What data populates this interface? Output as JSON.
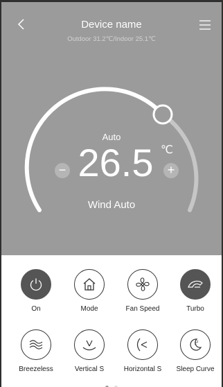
{
  "header": {
    "title": "Device name",
    "subtitle": "Outdoor 31.2℃/Indoor 25.1℃"
  },
  "thermostat": {
    "mode": "Auto",
    "temperature": "26.5",
    "unit": "℃",
    "minus": "−",
    "plus": "+",
    "wind": "Wind Auto"
  },
  "controls": {
    "row1": [
      "On",
      "Mode",
      "Fan Speed",
      "Turbo"
    ],
    "row2": [
      "Breezeless",
      "Vertical S",
      "Horizontal S",
      "Sleep Curve"
    ]
  },
  "colors": {
    "panel": "#9b9b9b",
    "active_button": "#555555",
    "accent": "#ffffff"
  }
}
